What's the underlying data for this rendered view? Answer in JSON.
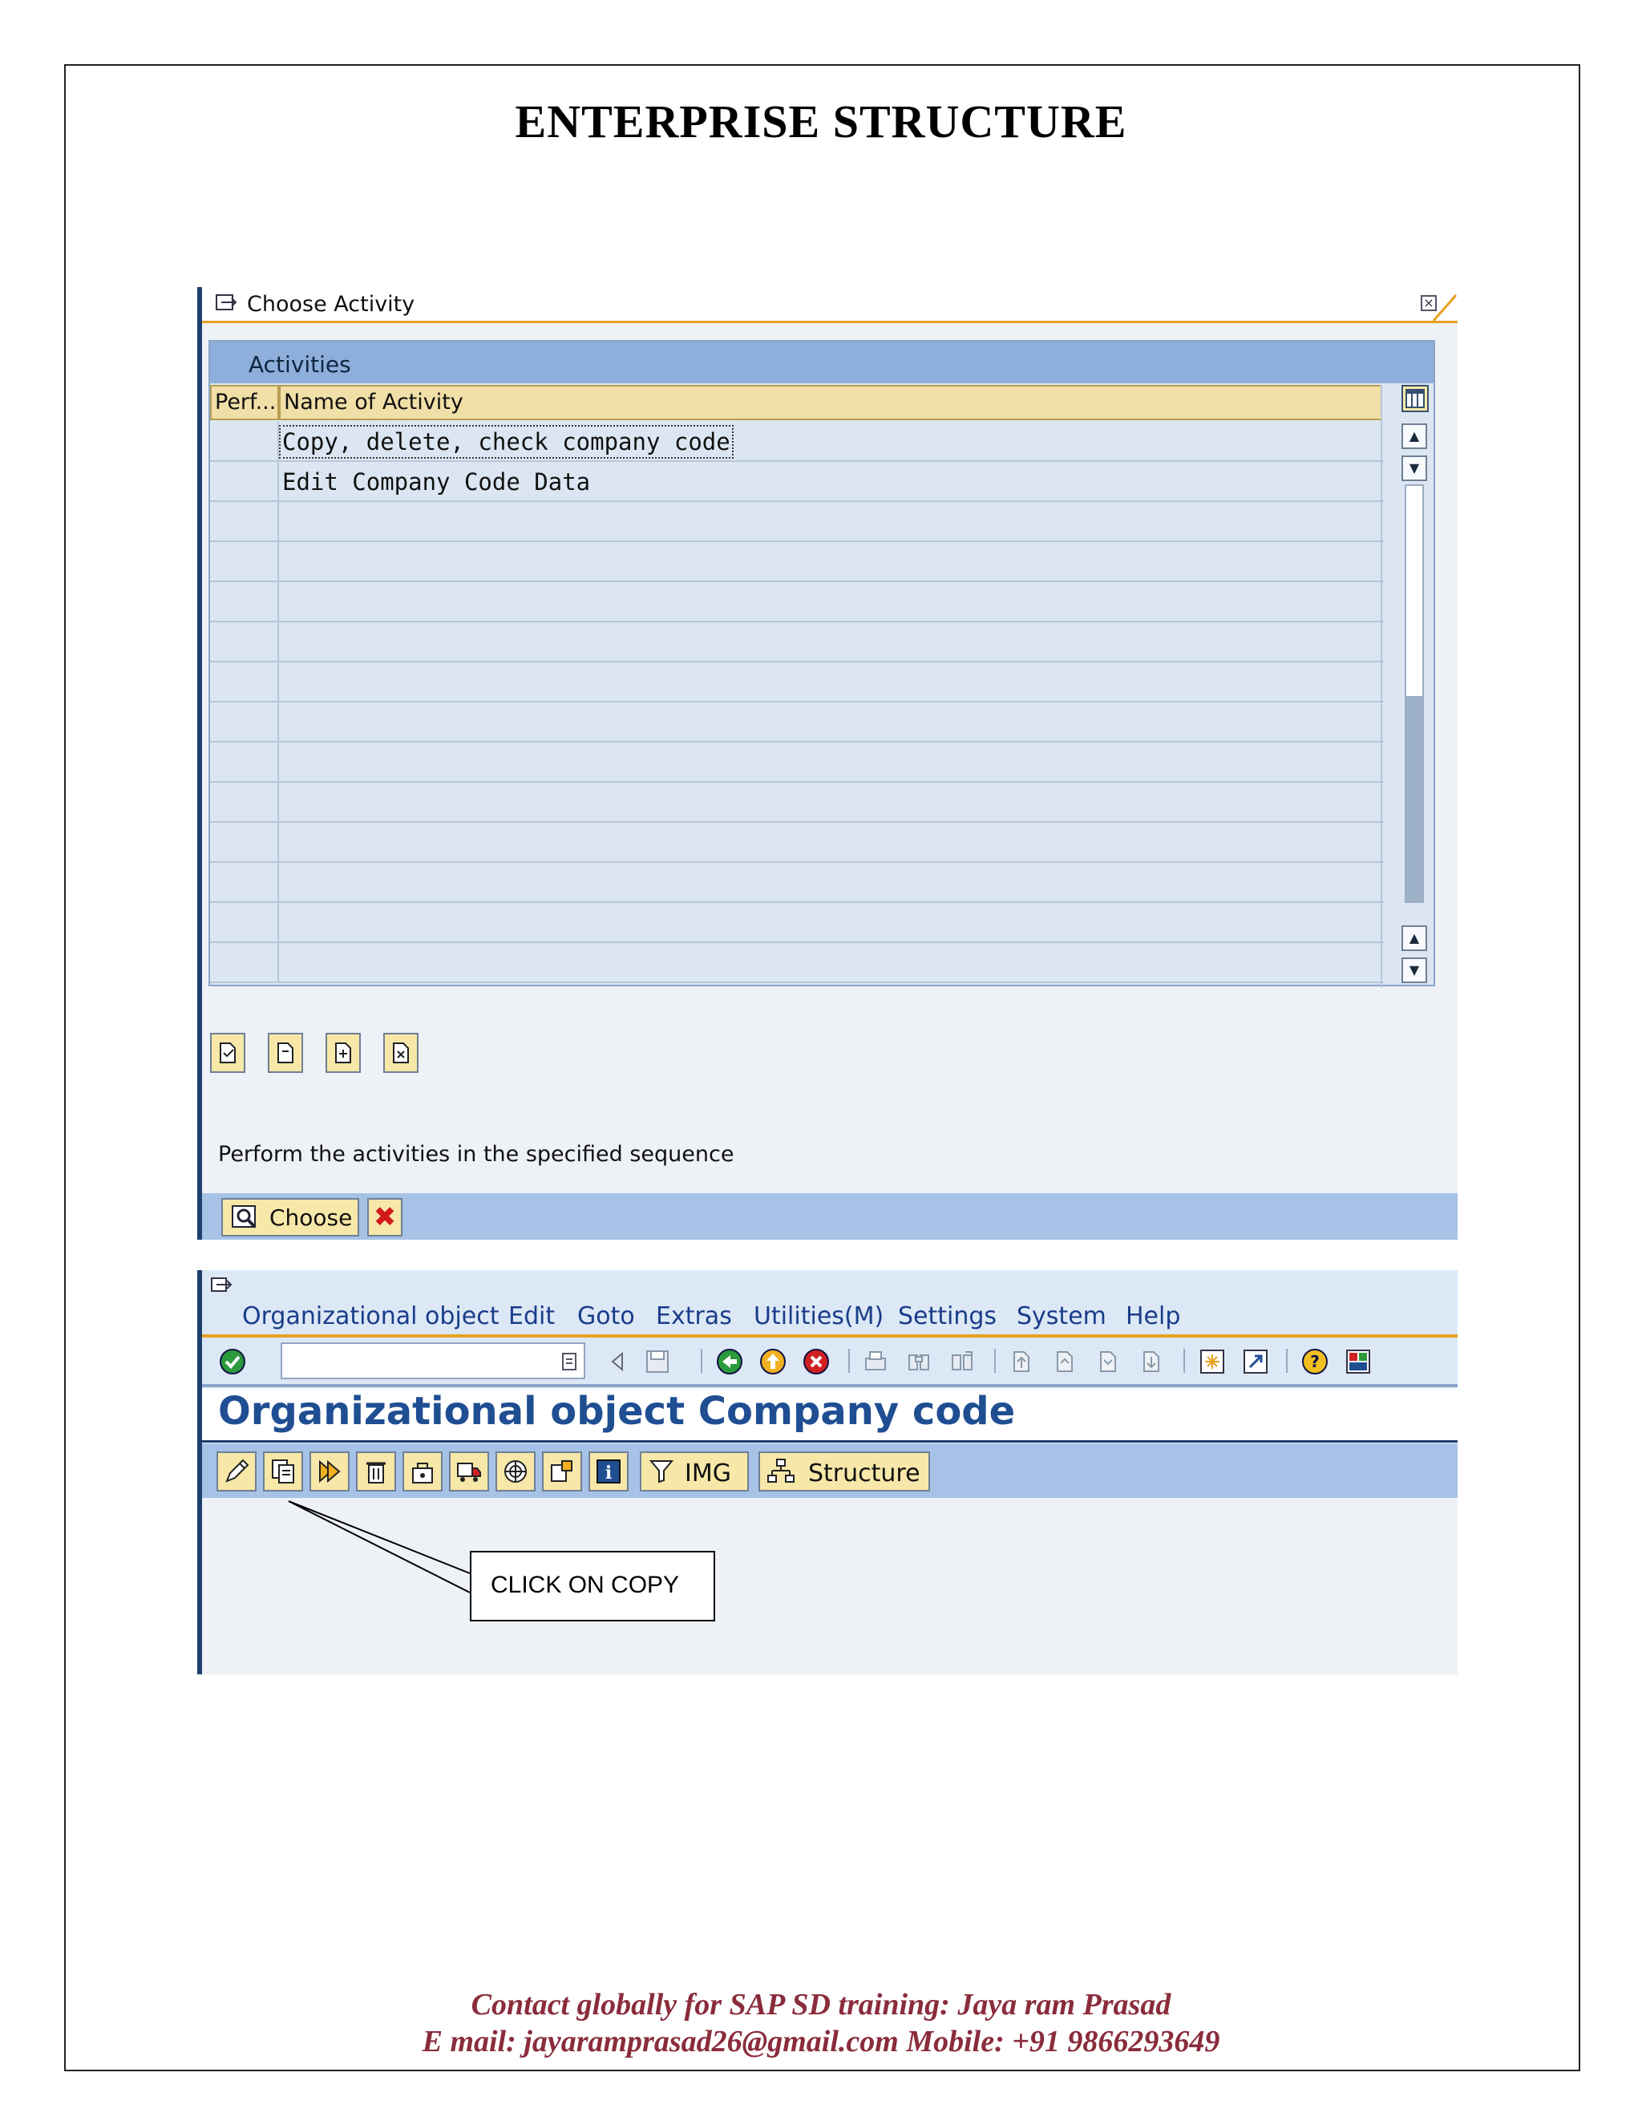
{
  "document": {
    "title": "ENTERPRISE STRUCTURE",
    "footer_line1": "Contact globally for SAP SD training:  Jaya ram Prasad",
    "footer_line2": "E mail: jayaramprasad26@gmail.com  Mobile: +91 9866293649",
    "callout": "CLICK ON COPY"
  },
  "dialog": {
    "title": "Choose Activity",
    "panel_header": "Activities",
    "columns": [
      "Perf...",
      "Name of Activity"
    ],
    "rows": [
      {
        "perf": "",
        "name": "Copy, delete, check company code"
      },
      {
        "perf": "",
        "name": "Edit Company Code Data"
      },
      {
        "perf": "",
        "name": ""
      },
      {
        "perf": "",
        "name": ""
      },
      {
        "perf": "",
        "name": ""
      },
      {
        "perf": "",
        "name": ""
      },
      {
        "perf": "",
        "name": ""
      },
      {
        "perf": "",
        "name": ""
      },
      {
        "perf": "",
        "name": ""
      },
      {
        "perf": "",
        "name": ""
      },
      {
        "perf": "",
        "name": ""
      },
      {
        "perf": "",
        "name": ""
      },
      {
        "perf": "",
        "name": ""
      },
      {
        "perf": "",
        "name": ""
      }
    ],
    "instruction": "Perform the activities in the specified sequence",
    "choose_label": "Choose"
  },
  "sap": {
    "menu": [
      "Organizational object",
      "Edit",
      "Goto",
      "Extras",
      "Utilities(M)",
      "Settings",
      "System",
      "Help"
    ],
    "command_field_value": "",
    "screen_title": "Organizational object Company code",
    "img_label": "IMG",
    "structure_label": "Structure"
  },
  "colors": {
    "accent_orange": "#e8a020",
    "header_blue": "#8eaedb",
    "title_blue": "#1f4e92",
    "footer_red": "#8a2c3c"
  }
}
